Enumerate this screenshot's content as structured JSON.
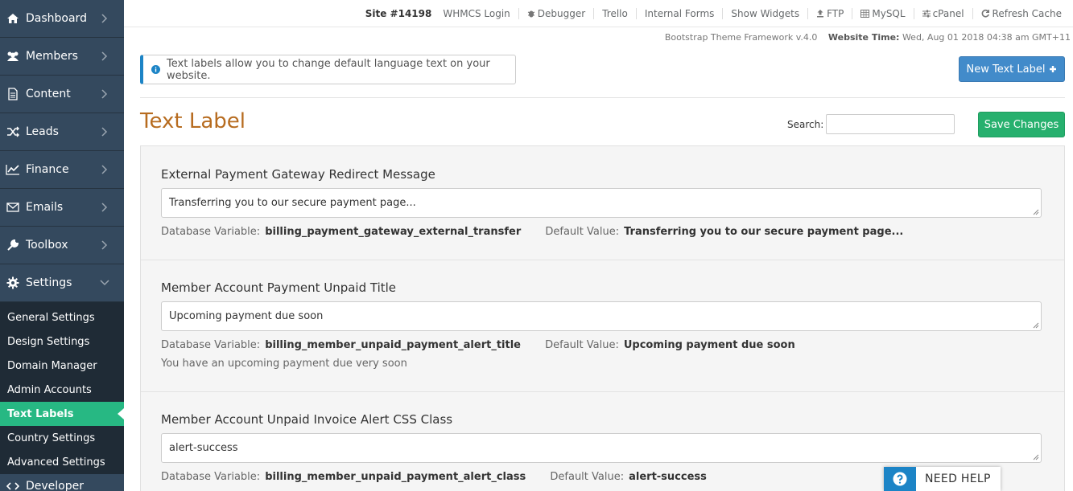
{
  "sidebar": {
    "items": [
      {
        "label": "Dashboard",
        "icon": "home-icon"
      },
      {
        "label": "Members",
        "icon": "users-icon"
      },
      {
        "label": "Content",
        "icon": "file-icon"
      },
      {
        "label": "Leads",
        "icon": "shuffle-icon"
      },
      {
        "label": "Finance",
        "icon": "chart-line-icon"
      },
      {
        "label": "Emails",
        "icon": "envelope-icon"
      },
      {
        "label": "Toolbox",
        "icon": "wrench-icon"
      },
      {
        "label": "Settings",
        "icon": "gear-icon"
      }
    ],
    "sub_items": [
      {
        "label": "General Settings"
      },
      {
        "label": "Design Settings"
      },
      {
        "label": "Domain Manager"
      },
      {
        "label": "Admin Accounts"
      },
      {
        "label": "Text Labels",
        "active": true
      },
      {
        "label": "Country Settings"
      },
      {
        "label": "Advanced Settings"
      }
    ],
    "partial_item": "Developer"
  },
  "topbar": {
    "site": "Site #14198",
    "whmcs": "WHMCS Login",
    "debugger": "Debugger",
    "trello": "Trello",
    "internal_forms": "Internal Forms",
    "show_widgets": "Show Widgets",
    "ftp": "FTP",
    "mysql": "MySQL",
    "cpanel": "cPanel",
    "refresh": "Refresh Cache"
  },
  "info": {
    "framework": "Bootstrap Theme Framework v.4.0",
    "time_label": "Website Time:",
    "time_value": "Wed, Aug 01 2018 04:38 am GMT+11"
  },
  "alert": {
    "text": "Text labels allow you to change default language text on your website."
  },
  "buttons": {
    "new_label": "New Text Label",
    "save": "Save Changes"
  },
  "page": {
    "title": "Text Label",
    "search_label": "Search:",
    "search_value": ""
  },
  "meta_labels": {
    "db": "Database Variable:",
    "default": "Default Value:"
  },
  "labels": [
    {
      "title": "External Payment Gateway Redirect Message",
      "value": "Transferring you to our secure payment page...",
      "db_var": "billing_payment_gateway_external_transfer",
      "default": "Transferring you to our secure payment page...",
      "note": ""
    },
    {
      "title": "Member Account Payment Unpaid Title",
      "value": "Upcoming payment due soon",
      "db_var": "billing_member_unpaid_payment_alert_title",
      "default": "Upcoming payment due soon",
      "note": "You have an upcoming payment due very soon"
    },
    {
      "title": "Member Account Unpaid Invoice Alert CSS Class",
      "value": "alert-success",
      "db_var": "billing_member_unpaid_payment_alert_class",
      "default": "alert-success",
      "note": ""
    }
  ],
  "help": {
    "label": "NEED HELP"
  },
  "colors": {
    "sidebar": "#2f4050",
    "active": "#27b883",
    "title": "#b76c20",
    "primary": "#428bca",
    "save": "#27b06e"
  }
}
